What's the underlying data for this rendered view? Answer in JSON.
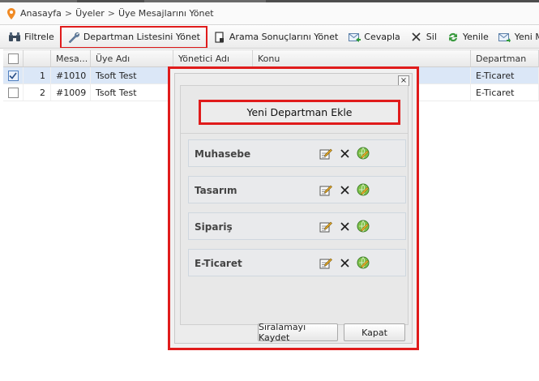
{
  "breadcrumb": {
    "items": [
      "Anasayfa",
      "Üyeler",
      "Üye Mesajlarını Yönet"
    ],
    "separator": ">"
  },
  "toolbar": {
    "filter": "Filtrele",
    "dept_list": "Departman Listesini Yönet",
    "search_results": "Arama Sonuçlarını Yönet",
    "reply": "Cevapla",
    "delete": "Sil",
    "refresh": "Yenile",
    "new_message": "Yeni Mesaj G"
  },
  "grid": {
    "columns": [
      "",
      "",
      "Mesa...",
      "Üye Adı",
      "Yönetici Adı",
      "Konu",
      "Departman"
    ],
    "rows": [
      {
        "checked": true,
        "no": "1",
        "msg": "#1010",
        "user": "Tsoft Test",
        "admin": "",
        "topic": "",
        "dept": "E-Ticaret"
      },
      {
        "checked": false,
        "no": "2",
        "msg": "#1009",
        "user": "Tsoft Test",
        "admin": "",
        "topic": "",
        "dept": "E-Ticaret"
      }
    ]
  },
  "modal": {
    "close": "×",
    "add_department": "Yeni Departman Ekle",
    "departments": [
      "Muhasebe",
      "Tasarım",
      "Sipariş",
      "E-Ticaret"
    ],
    "save_order": "Sıralamayı Kaydet",
    "close_button": "Kapat"
  },
  "colors": {
    "highlight": "#e01b1b",
    "selected_row": "#dbe7f7"
  }
}
